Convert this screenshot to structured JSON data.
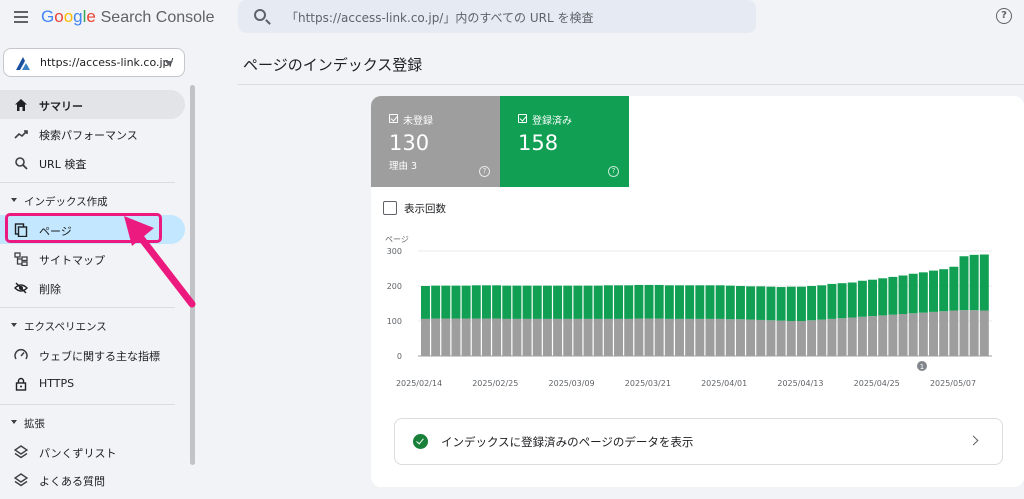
{
  "header": {
    "logo_google": "Google",
    "logo_product": "Search Console",
    "search_placeholder": "「https://access-link.co.jp/」内のすべての URL を検査"
  },
  "property": {
    "url": "https://access-link.co.jp/"
  },
  "sidebar": {
    "items": [
      {
        "label": "サマリー",
        "icon": "home-icon"
      },
      {
        "label": "検索パフォーマンス",
        "icon": "trending-up-icon"
      },
      {
        "label": "URL 検査",
        "icon": "search-icon"
      }
    ],
    "sections": [
      {
        "label": "インデックス作成",
        "items": [
          {
            "label": "ページ",
            "icon": "pages-icon"
          },
          {
            "label": "サイトマップ",
            "icon": "sitemap-icon"
          },
          {
            "label": "削除",
            "icon": "removal-eye-icon"
          }
        ]
      },
      {
        "label": "エクスペリエンス",
        "items": [
          {
            "label": "ウェブに関する主な指標",
            "icon": "speed-gauge-icon"
          },
          {
            "label": "HTTPS",
            "icon": "lock-icon"
          }
        ]
      },
      {
        "label": "拡張",
        "items": [
          {
            "label": "パンくずリスト",
            "icon": "layers-icon"
          },
          {
            "label": "よくある質問",
            "icon": "layers-icon"
          }
        ]
      }
    ]
  },
  "main": {
    "title": "ページのインデックス登録",
    "tiles": [
      {
        "label": "未登録",
        "value": "130",
        "sub": "理由 3",
        "color": "#9e9e9e"
      },
      {
        "label": "登録済み",
        "value": "158",
        "color": "#11a053"
      }
    ],
    "impressions_label": "表示回数",
    "index_link_text": "インデックスに登録済みのページのデータを表示"
  },
  "chart_data": {
    "type": "bar",
    "stacked": true,
    "ylabel": "ページ",
    "ylim": [
      0,
      300
    ],
    "yticks": [
      "300",
      "200",
      "100",
      "0"
    ],
    "xtick_labels": [
      "2025/02/14",
      "2025/02/25",
      "2025/03/09",
      "2025/03/21",
      "2025/04/01",
      "2025/04/13",
      "2025/04/25",
      "2025/05/07"
    ],
    "annotation": "1",
    "series": [
      {
        "color": "#9e9e9e",
        "values": [
          106,
          107,
          107,
          107,
          107,
          107,
          107,
          107,
          106,
          106,
          106,
          106,
          106,
          106,
          106,
          106,
          106,
          106,
          106,
          106,
          106,
          107,
          107,
          107,
          106,
          106,
          106,
          106,
          106,
          106,
          105,
          105,
          104,
          103,
          102,
          101,
          100,
          100,
          102,
          104,
          106,
          108,
          110,
          112,
          114,
          116,
          118,
          120,
          122,
          124,
          126,
          128,
          130,
          131,
          131,
          130
        ]
      },
      {
        "color": "#11a053",
        "values": [
          94,
          94,
          94,
          94,
          94,
          95,
          95,
          95,
          95,
          95,
          95,
          95,
          95,
          95,
          95,
          95,
          95,
          95,
          96,
          96,
          96,
          96,
          96,
          96,
          96,
          96,
          96,
          96,
          96,
          96,
          96,
          95,
          95,
          96,
          96,
          96,
          98,
          98,
          98,
          98,
          100,
          100,
          100,
          103,
          104,
          106,
          108,
          110,
          113,
          115,
          118,
          120,
          125,
          154,
          158,
          160
        ]
      }
    ]
  }
}
